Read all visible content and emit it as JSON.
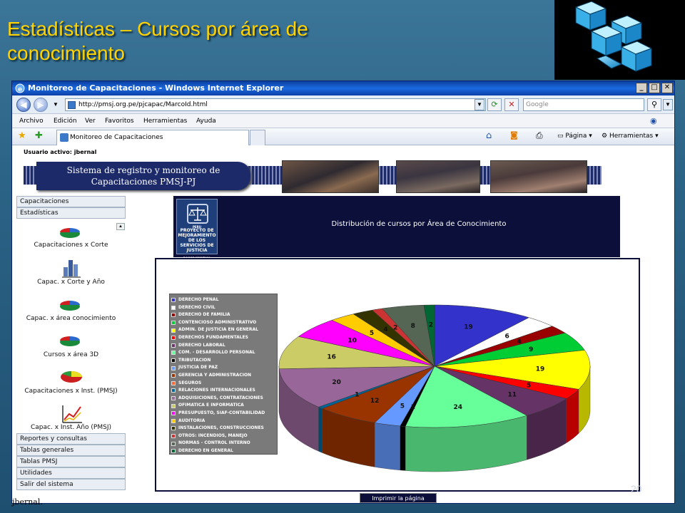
{
  "slide": {
    "title_line1": "Estadísticas – Cursos por área de",
    "title_line2": "conocimiento",
    "page_number": "20"
  },
  "browser": {
    "window_title": "Monitoreo de Capacitaciones - Windows Internet Explorer",
    "address": "http://pmsj.org.pe/pjcapac/MarcoId.html",
    "search_placeholder": "Google",
    "menu": [
      "Archivo",
      "Edición",
      "Ver",
      "Favoritos",
      "Herramientas",
      "Ayuda"
    ],
    "tab_title": "Monitoreo de Capacitaciones",
    "cmd_page": "Página",
    "cmd_tools": "Herramientas"
  },
  "app": {
    "user_active": "Usuario activo: jbernal",
    "banner_line1": "Sistema de registro y monitoreo de",
    "banner_line2": "Capacitaciones PMSJ-PJ",
    "logo_top": "PERU",
    "logo_text": "PROYECTO DE MEJORAMIENTO DE LOS SERVICIOS DE JUSTICIA",
    "logo_bottom": "BANCO MUNDIAL",
    "chart_heading": "Distribución de cursos por Área de Conocimiento",
    "print_label": "Imprimir la página",
    "status_user": "jbernal."
  },
  "sidebar": {
    "top_items": [
      "Capacitaciones",
      "Estadísticas"
    ],
    "links": [
      {
        "label": "Capacitaciones x Corte",
        "icon": "pie-chart-icon"
      },
      {
        "label": "Capac. x Corte y Año",
        "icon": "bar-chart-3d-icon"
      },
      {
        "label": "Capac. x área conocimiento",
        "icon": "pie-chart-icon"
      },
      {
        "label": "Cursos x área 3D",
        "icon": "pie-chart-3d-icon"
      },
      {
        "label": "Capacitaciones x Inst. (PMSJ)",
        "icon": "pie-chart-red-icon"
      },
      {
        "label": "Capac. x  Inst. Año (PMSJ)",
        "icon": "line-chart-icon"
      }
    ],
    "bottom_items": [
      "Reportes y consultas",
      "Tablas generales",
      "Tablas PMSJ",
      "Utilidades",
      "Salir del sistema"
    ]
  },
  "chart_data": {
    "type": "pie",
    "title": "Distribución de cursos por Área de Conocimiento",
    "legend_position": "left",
    "slices": [
      {
        "name": "DERECHO PENAL",
        "value": 19,
        "color": "#3333cc"
      },
      {
        "name": "DERECHO CIVIL",
        "value": 6,
        "color": "#ffffff"
      },
      {
        "name": "DERECHO DE FAMILIA",
        "value": 4,
        "color": "#990000"
      },
      {
        "name": "CONTENCIOSO ADMINISTRATIVO",
        "value": 9,
        "color": "#00cc33"
      },
      {
        "name": "ADMIN. DE JUSTICIA EN GENERAL",
        "value": 19,
        "color": "#ffff00"
      },
      {
        "name": "DERECHOS FUNDAMENTALES",
        "value": 5,
        "color": "#ff0000"
      },
      {
        "name": "DERECHO LABORAL",
        "value": 11,
        "color": "#663366"
      },
      {
        "name": "COM. - DESARROLLO PERSONAL",
        "value": 24,
        "color": "#66ff99"
      },
      {
        "name": "TRIBUTACION",
        "value": 1,
        "color": "#000000"
      },
      {
        "name": "JUSTICIA DE PAZ",
        "value": 5,
        "color": "#6699ff"
      },
      {
        "name": "GERENCIA Y ADMINISTRACION",
        "value": 12,
        "color": "#993300"
      },
      {
        "name": "SEGUROS",
        "value": 0,
        "color": "#ff6633"
      },
      {
        "name": "RELACIONES INTERNACIONALES",
        "value": 1,
        "color": "#006699"
      },
      {
        "name": "ADQUISICIONES, CONTRATACIONES",
        "value": 20,
        "color": "#996699"
      },
      {
        "name": "OFIMATICA E INFORMATICA",
        "value": 16,
        "color": "#cccc66"
      },
      {
        "name": "PRESUPUESTO, SIAF-CONTABILIDAD",
        "value": 10,
        "color": "#ff00ff"
      },
      {
        "name": "AUDITORIA",
        "value": 5,
        "color": "#ffcc00"
      },
      {
        "name": "INSTALACIONES, CONSTRUCCIONES",
        "value": 4,
        "color": "#333300"
      },
      {
        "name": "OTROS: INCENDIOS, MANEJO",
        "value": 2,
        "color": "#cc3333"
      },
      {
        "name": "NORMAS - CONTROL INTERNO",
        "value": 8,
        "color": "#556655"
      },
      {
        "name": "DERECHO EN GENERAL",
        "value": 2,
        "color": "#006633"
      }
    ]
  }
}
